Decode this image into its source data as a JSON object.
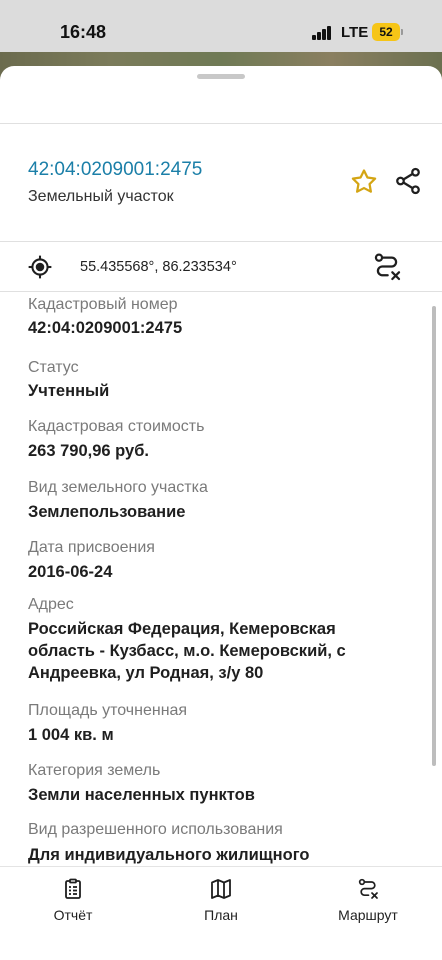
{
  "status_bar": {
    "time": "16:48",
    "network": "LTE",
    "battery": "52"
  },
  "header": {
    "cadastral_number": "42:04:0209001:2475",
    "object_type": "Земельный участок",
    "favorite_icon": "star-icon",
    "share_icon": "share-icon"
  },
  "location": {
    "coordinates": "55.435568°, 86.233534°",
    "locate_icon": "crosshair-icon",
    "route_icon": "route-cancel-icon"
  },
  "fields": [
    {
      "label": "Кадастровый номер",
      "value": "42:04:0209001:2475"
    },
    {
      "label": "Статус",
      "value": "Учтенный"
    },
    {
      "label": "Кадастровая стоимость",
      "value": "263 790,96 руб."
    },
    {
      "label": "Вид земельного участка",
      "value": "Землепользование"
    },
    {
      "label": "Дата присвоения",
      "value": "2016-06-24"
    },
    {
      "label": "Адрес",
      "value_lines": [
        "Российская Федерация, Кемеровская",
        "область - Кузбасс, м.о. Кемеровский, с",
        "Андреевка, ул Родная, з/у 80"
      ]
    },
    {
      "label": "Площадь уточненная",
      "value": "1 004 кв. м"
    },
    {
      "label": "Категория земель",
      "value": "Земли населенных пунктов"
    },
    {
      "label": "Вид разрешенного использования",
      "value": "Для индивидуального жилищного"
    }
  ],
  "bottom_nav": [
    {
      "label": "Отчёт",
      "icon": "report-icon"
    },
    {
      "label": "План",
      "icon": "map-icon"
    },
    {
      "label": "Маршрут",
      "icon": "route-icon"
    }
  ],
  "colors": {
    "accent": "#1b7fa8",
    "star": "#d4a514",
    "battery": "#f6c517"
  }
}
